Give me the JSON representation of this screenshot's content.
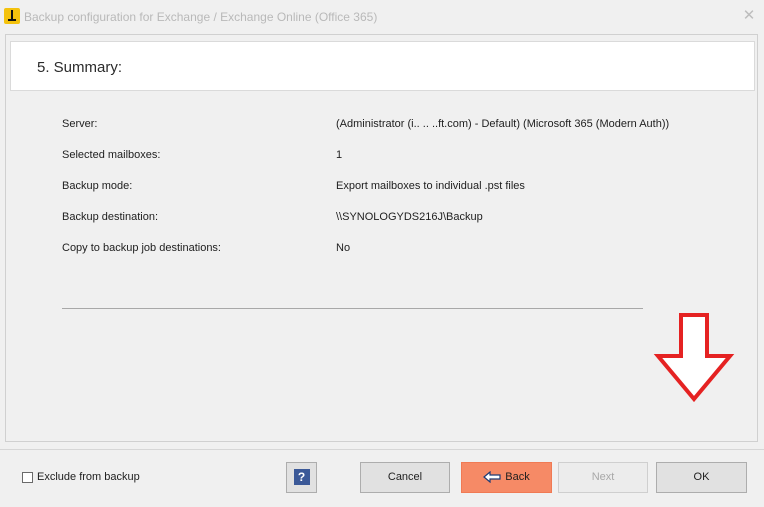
{
  "window": {
    "title": "Backup configuration for Exchange / Exchange Online (Office 365)",
    "close_glyph": "✕"
  },
  "header": {
    "step_title": "5. Summary:"
  },
  "summary": {
    "rows": [
      {
        "label": "Server:",
        "value": "(Administrator (i.. .. ..ft.com) - Default) (Microsoft 365 (Modern Auth))"
      },
      {
        "label": "Selected mailboxes:",
        "value": "1"
      },
      {
        "label": "Backup mode:",
        "value": "Export mailboxes to individual .pst files"
      },
      {
        "label": "Backup destination:",
        "value": "\\\\SYNOLOGYDS216J\\Backup"
      },
      {
        "label": "Copy to backup job destinations:",
        "value": "No"
      }
    ]
  },
  "footer": {
    "exclude_label": "Exclude from backup",
    "help_glyph": "?",
    "cancel_label": "Cancel",
    "back_label": "Back",
    "next_label": "Next",
    "ok_label": "OK"
  },
  "colors": {
    "back_button": "#f68a66",
    "annotation_arrow": "#e52222",
    "help_icon": "#3b5998"
  },
  "icons": {
    "app": "app-logo-icon",
    "close": "close-icon",
    "help": "help-icon",
    "back": "arrow-left-icon",
    "annotation": "down-arrow-annotation"
  }
}
